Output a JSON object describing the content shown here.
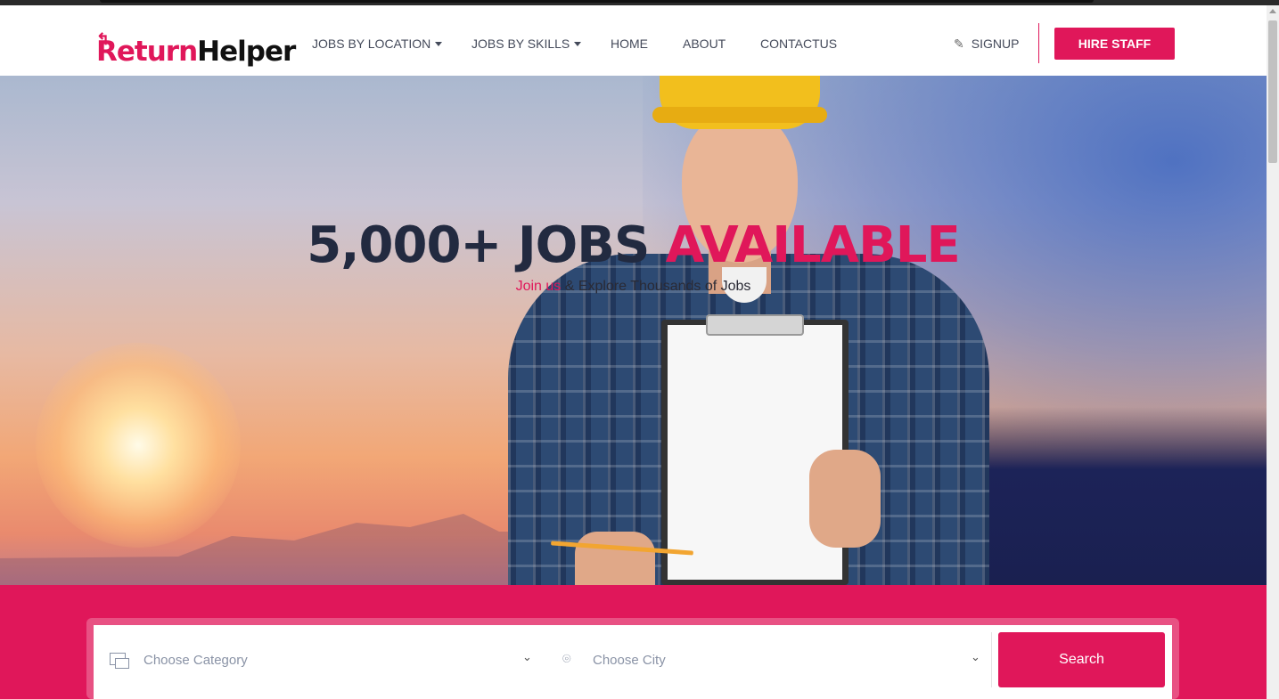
{
  "brand": {
    "logo_text_1": "Return",
    "logo_text_2": "Helper"
  },
  "nav": {
    "items": [
      {
        "label": "JOBS BY LOCATION",
        "dropdown": true
      },
      {
        "label": "JOBS BY SKILLS",
        "dropdown": true
      },
      {
        "label": "HOME",
        "dropdown": false
      },
      {
        "label": "ABOUT",
        "dropdown": false
      },
      {
        "label": "CONTACTUS",
        "dropdown": false
      }
    ],
    "signup_label": "SIGNUP",
    "hire_label": "HIRE STAFF"
  },
  "hero": {
    "title_main": "5,000+ JOBS ",
    "title_accent": "AVAILABLE",
    "subtitle_accent": "Join us",
    "subtitle_rest": " & Explore Thousands of Jobs"
  },
  "search": {
    "category_placeholder": "Choose Category",
    "city_placeholder": "Choose City",
    "button_label": "Search"
  },
  "colors": {
    "accent": "#e0175a",
    "text_dark": "#222a40",
    "nav_text": "#444a5a"
  },
  "icons": [
    "pencil-icon",
    "category-icon",
    "location-pin-icon",
    "chevron-down-icon",
    "caret-down-icon"
  ]
}
